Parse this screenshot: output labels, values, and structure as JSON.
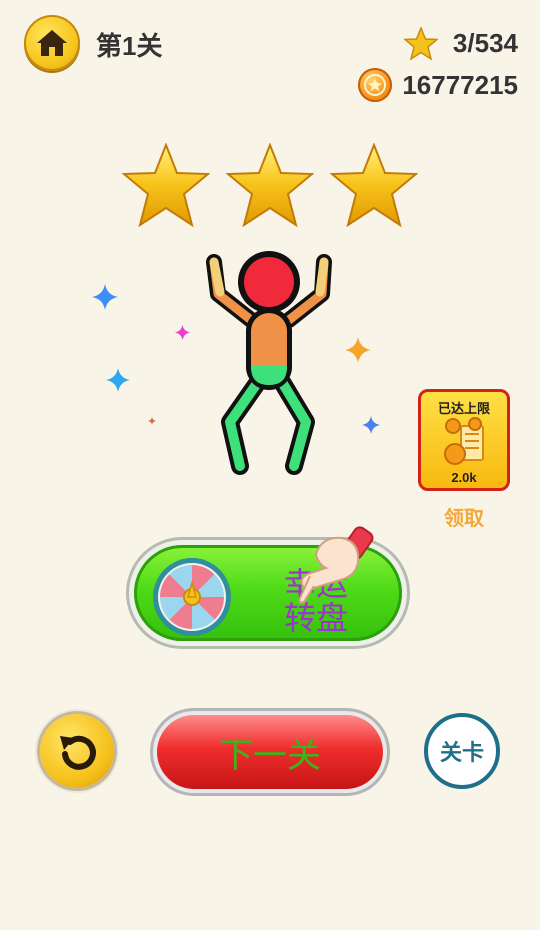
{
  "header": {
    "level_label": "第1关",
    "stars_count": "3/534",
    "coins_count": "16777215"
  },
  "gift": {
    "title": "已达上限",
    "amount": "2.0k",
    "claim_label": "领取"
  },
  "wheel_button": {
    "label_line1": "幸运",
    "label_line2": "转盘"
  },
  "next_button": {
    "label": "下一关"
  },
  "levels_button": {
    "label": "关卡"
  },
  "rating": {
    "stars_earned": 3,
    "stars_total": 3
  },
  "colors": {
    "background": "#f8f4e8",
    "star_gold": "#f5c21b",
    "wheel_button_green": "#4fdb18",
    "next_button_red": "#ef2d2d",
    "levels_button_teal": "#1f6f8a",
    "claim_orange": "#f2a93c"
  },
  "icons": [
    "home-icon",
    "star-icon",
    "coin-icon",
    "retry-icon",
    "wheel-icon",
    "pointing-hand-icon",
    "coin-stack-icon"
  ]
}
